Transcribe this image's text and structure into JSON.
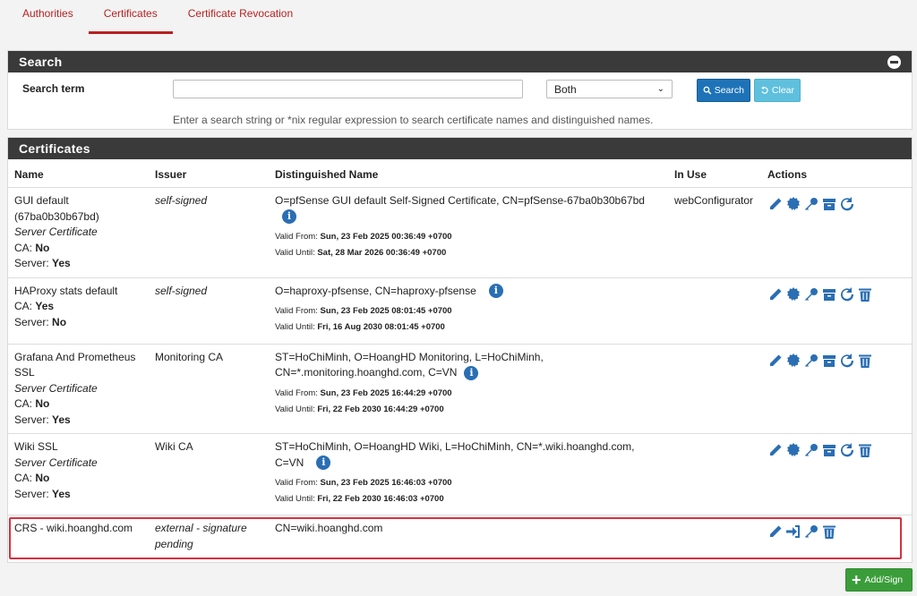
{
  "tabs": [
    {
      "label": "Authorities",
      "active": false
    },
    {
      "label": "Certificates",
      "active": true
    },
    {
      "label": "Certificate Revocation",
      "active": false
    }
  ],
  "search": {
    "title": "Search",
    "term_label": "Search term",
    "input_value": "",
    "scope_value": "Both",
    "search_button": "Search",
    "clear_button": "Clear",
    "help": "Enter a search string or *nix regular expression to search certificate names and distinguished names."
  },
  "certs": {
    "title": "Certificates",
    "columns": [
      "Name",
      "Issuer",
      "Distinguished Name",
      "In Use",
      "Actions"
    ],
    "rows": [
      {
        "name": "GUI default (67ba0b30b67bd)",
        "type": "Server Certificate",
        "ca_label": "CA:",
        "ca": "No",
        "server_label": "Server:",
        "server": "Yes",
        "issuer": "self-signed",
        "dn": "O=pfSense GUI default Self-Signed Certificate, CN=pfSense-67ba0b30b67bd",
        "valid_from_label": "Valid From:",
        "valid_from": "Sun, 23 Feb 2025 00:36:49 +0700",
        "valid_until_label": "Valid Until:",
        "valid_until": "Sat, 28 Mar 2026 00:36:49 +0700",
        "in_use": "webConfigurator"
      },
      {
        "name": "HAProxy stats default",
        "type": "",
        "ca_label": "CA:",
        "ca": "Yes",
        "server_label": "Server:",
        "server": "No",
        "issuer": "self-signed",
        "dn": "O=haproxy-pfsense, CN=haproxy-pfsense",
        "valid_from_label": "Valid From:",
        "valid_from": "Sun, 23 Feb 2025 08:01:45 +0700",
        "valid_until_label": "Valid Until:",
        "valid_until": "Fri, 16 Aug 2030 08:01:45 +0700",
        "in_use": ""
      },
      {
        "name": "Grafana And Prometheus SSL",
        "type": "Server Certificate",
        "ca_label": "CA:",
        "ca": "No",
        "server_label": "Server:",
        "server": "Yes",
        "issuer": "Monitoring CA",
        "dn": "ST=HoChiMinh, O=HoangHD Monitoring, L=HoChiMinh, CN=*.monitoring.hoanghd.com, C=VN",
        "valid_from_label": "Valid From:",
        "valid_from": "Sun, 23 Feb 2025 16:44:29 +0700",
        "valid_until_label": "Valid Until:",
        "valid_until": "Fri, 22 Feb 2030 16:44:29 +0700",
        "in_use": ""
      },
      {
        "name": "Wiki SSL",
        "type": "Server Certificate",
        "ca_label": "CA:",
        "ca": "No",
        "server_label": "Server:",
        "server": "Yes",
        "issuer": "Wiki CA",
        "dn": "ST=HoChiMinh, O=HoangHD Wiki, L=HoChiMinh, CN=*.wiki.hoanghd.com, C=VN",
        "valid_from_label": "Valid From:",
        "valid_from": "Sun, 23 Feb 2025 16:46:03 +0700",
        "valid_until_label": "Valid Until:",
        "valid_until": "Fri, 22 Feb 2030 16:46:03 +0700",
        "in_use": ""
      },
      {
        "name": "CRS - wiki.hoanghd.com",
        "issuer": "external - signature pending",
        "dn": "CN=wiki.hoanghd.com",
        "in_use": ""
      }
    ]
  },
  "add_sign_button": "Add/Sign",
  "colors": {
    "accent": "#b72121",
    "primary": "#2a6eb3",
    "success": "#3a9d3a",
    "panel_head": "#3a3a3a",
    "highlight": "#d9303f"
  }
}
